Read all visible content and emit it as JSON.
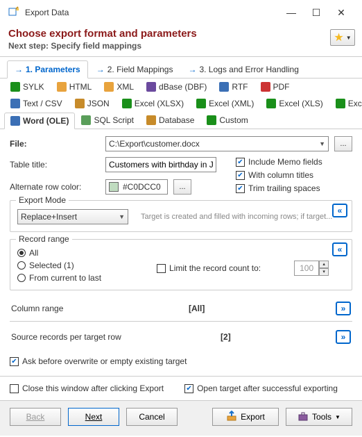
{
  "window": {
    "title": "Export Data"
  },
  "header": {
    "title": "Choose export format and parameters",
    "next_step": "Next step: Specify field mappings"
  },
  "steps": [
    {
      "label": "1. Parameters",
      "active": true
    },
    {
      "label": "2. Field Mappings",
      "active": false
    },
    {
      "label": "3. Logs and Error Handling",
      "active": false
    }
  ],
  "formats_row1": [
    {
      "label": "SYLK",
      "color": "#1a8f1a"
    },
    {
      "label": "HTML",
      "color": "#e8a33d"
    },
    {
      "label": "XML",
      "color": "#e8a33d"
    },
    {
      "label": "dBase (DBF)",
      "color": "#6b4a9e"
    },
    {
      "label": "RTF",
      "color": "#3b6fb5"
    },
    {
      "label": "PDF",
      "color": "#c33"
    }
  ],
  "formats_row2": [
    {
      "label": "Text / CSV",
      "color": "#3b6fb5"
    },
    {
      "label": "JSON",
      "color": "#c78b2a"
    },
    {
      "label": "Excel (XLSX)",
      "color": "#1a8f1a"
    },
    {
      "label": "Excel (XML)",
      "color": "#1a8f1a"
    },
    {
      "label": "Excel (XLS)",
      "color": "#1a8f1a"
    },
    {
      "label": "Excel (OLE)",
      "color": "#1a8f1a"
    }
  ],
  "formats_row3": [
    {
      "label": "Word (OLE)",
      "color": "#3b6fb5",
      "active": true
    },
    {
      "label": "SQL Script",
      "color": "#5a9e5a"
    },
    {
      "label": "Database",
      "color": "#c78b2a"
    },
    {
      "label": "Custom",
      "color": "#1a8f1a"
    }
  ],
  "fields": {
    "file_label": "File:",
    "file_value": "C:\\Export\\customer.docx",
    "browse_label": "...",
    "table_title_label": "Table title:",
    "table_title_value": "Customers with birthday in Jul",
    "alt_row_label": "Alternate row color:",
    "alt_row_color": "#C0DCC0",
    "color_btn": "..."
  },
  "options": {
    "memo": {
      "label": "Include Memo fields",
      "checked": true
    },
    "coltitles": {
      "label": "With column titles",
      "checked": true
    },
    "trim": {
      "label": "Trim trailing spaces",
      "checked": true
    }
  },
  "export_mode": {
    "title": "Export Mode",
    "value": "Replace+Insert",
    "hint": "Target is created and filled with incoming rows; if target..."
  },
  "record_range": {
    "title": "Record range",
    "all": "All",
    "selected": "Selected (1)",
    "from_current": "From current to last",
    "limit_label": "Limit the record count to:",
    "limit_value": "100"
  },
  "column_range": {
    "label": "Column range",
    "value": "[All]"
  },
  "source_per_row": {
    "label": "Source records per target row",
    "value": "[2]"
  },
  "ask_overwrite": {
    "label": "Ask before overwrite or empty existing target",
    "checked": true
  },
  "footer_opts": {
    "close_after": {
      "label": "Close this window after clicking Export",
      "checked": false
    },
    "open_target": {
      "label": "Open target after successful exporting",
      "checked": true
    }
  },
  "buttons": {
    "back": "Back",
    "next": "Next",
    "cancel": "Cancel",
    "export": "Export",
    "tools": "Tools"
  }
}
